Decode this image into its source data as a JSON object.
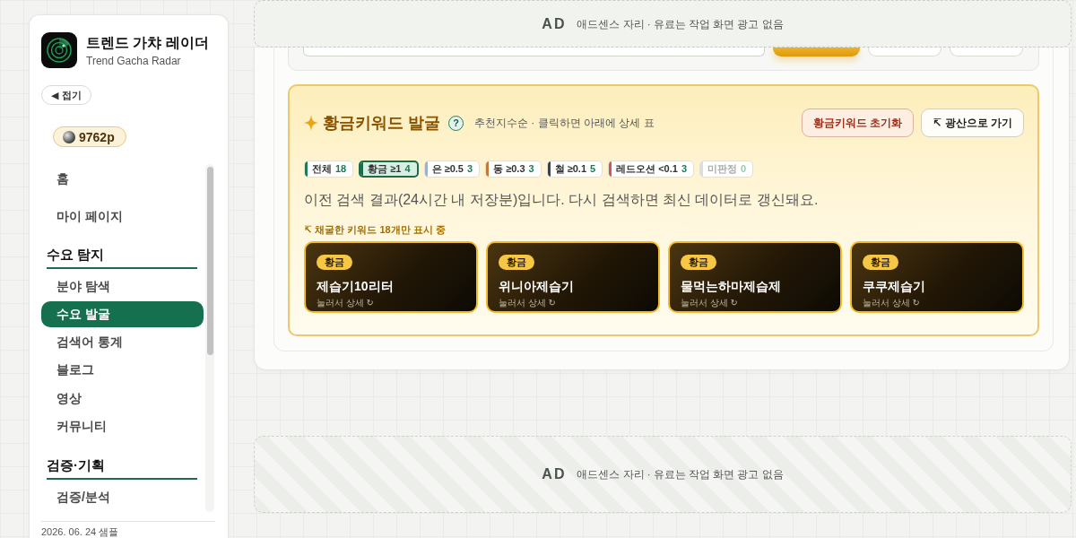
{
  "sidebar": {
    "app_title": "트렌드 가챠 레이더",
    "app_subtitle": "Trend Gacha Radar",
    "collapse_button": "◀ 접기",
    "points": "9762p",
    "nav": [
      {
        "kind": "link",
        "label": "홈",
        "selected": false
      },
      {
        "kind": "link",
        "label": "마이 페이지",
        "selected": false
      },
      {
        "kind": "section",
        "title": "수요 탐지",
        "items": [
          {
            "label": "분야 탐색",
            "selected": false
          },
          {
            "label": "수요 발굴",
            "selected": true
          },
          {
            "label": "검색어 통계",
            "selected": false
          },
          {
            "label": "블로그",
            "selected": false
          },
          {
            "label": "영상",
            "selected": false
          },
          {
            "label": "커뮤니티",
            "selected": false
          }
        ]
      },
      {
        "kind": "section",
        "title": "검증·기획",
        "items": [
          {
            "label": "검증/분석",
            "selected": false
          }
        ]
      }
    ],
    "footer": "2026. 06. 24 샘플"
  },
  "top_ad": {
    "tag": "AD",
    "text": "애드센스 자리 · 유료는 작업 화면 광고 없음"
  },
  "search_bar": {
    "controls": [
      {
        "kind": "field"
      },
      {
        "kind": "primary"
      },
      {
        "kind": "secondary"
      },
      {
        "kind": "secondary"
      }
    ]
  },
  "golden_panel": {
    "title": "황금키워드 발굴",
    "help": "?",
    "subtitle": "추천지수순 · 클릭하면 아래에 상세 표",
    "buttons": [
      {
        "kind": "danger",
        "label": "황금키워드 초기화"
      },
      {
        "kind": "plain",
        "label": "↸ 광산으로 가기"
      }
    ],
    "filters": [
      {
        "label": "전체",
        "count": "18",
        "color": "#1d7a55",
        "selected": false,
        "disabled": false
      },
      {
        "label": "황금 ≥1",
        "count": "4",
        "color": "#1d6b4a",
        "selected": true,
        "disabled": false
      },
      {
        "label": "은 ≥0.5",
        "count": "3",
        "color": "#9fb0c8",
        "selected": false,
        "disabled": false
      },
      {
        "label": "동 ≥0.3",
        "count": "3",
        "color": "#c27a3c",
        "selected": false,
        "disabled": false
      },
      {
        "label": "철 ≥0.1",
        "count": "5",
        "color": "#35405a",
        "selected": false,
        "disabled": false
      },
      {
        "label": "레드오션 <0.1",
        "count": "3",
        "color": "#d9534f",
        "selected": false,
        "disabled": false
      },
      {
        "label": "미판정",
        "count": "0",
        "color": "#dcdcdc",
        "selected": false,
        "disabled": true
      }
    ],
    "notice": "이전 검색 결과(24시간 내 저장분)입니다. 다시 검색하면 최신 데이터로 갱신돼요.",
    "filter_note": "↸ 채굴한 키워드 18개만 표시 중",
    "keywords": [
      {
        "tier": "황금",
        "name": "제습기10리터",
        "hint": "눌러서 상세 ↻"
      },
      {
        "tier": "황금",
        "name": "위니아제습기",
        "hint": "눌러서 상세 ↻"
      },
      {
        "tier": "황금",
        "name": "물먹는하마제습제",
        "hint": "눌러서 상세 ↻"
      },
      {
        "tier": "황금",
        "name": "쿠쿠제습기",
        "hint": "눌러서 상세 ↻"
      }
    ]
  },
  "bottom_ad": {
    "tag": "AD",
    "text": "애드센스 자리 · 유료는 작업 화면 광고 없음"
  }
}
